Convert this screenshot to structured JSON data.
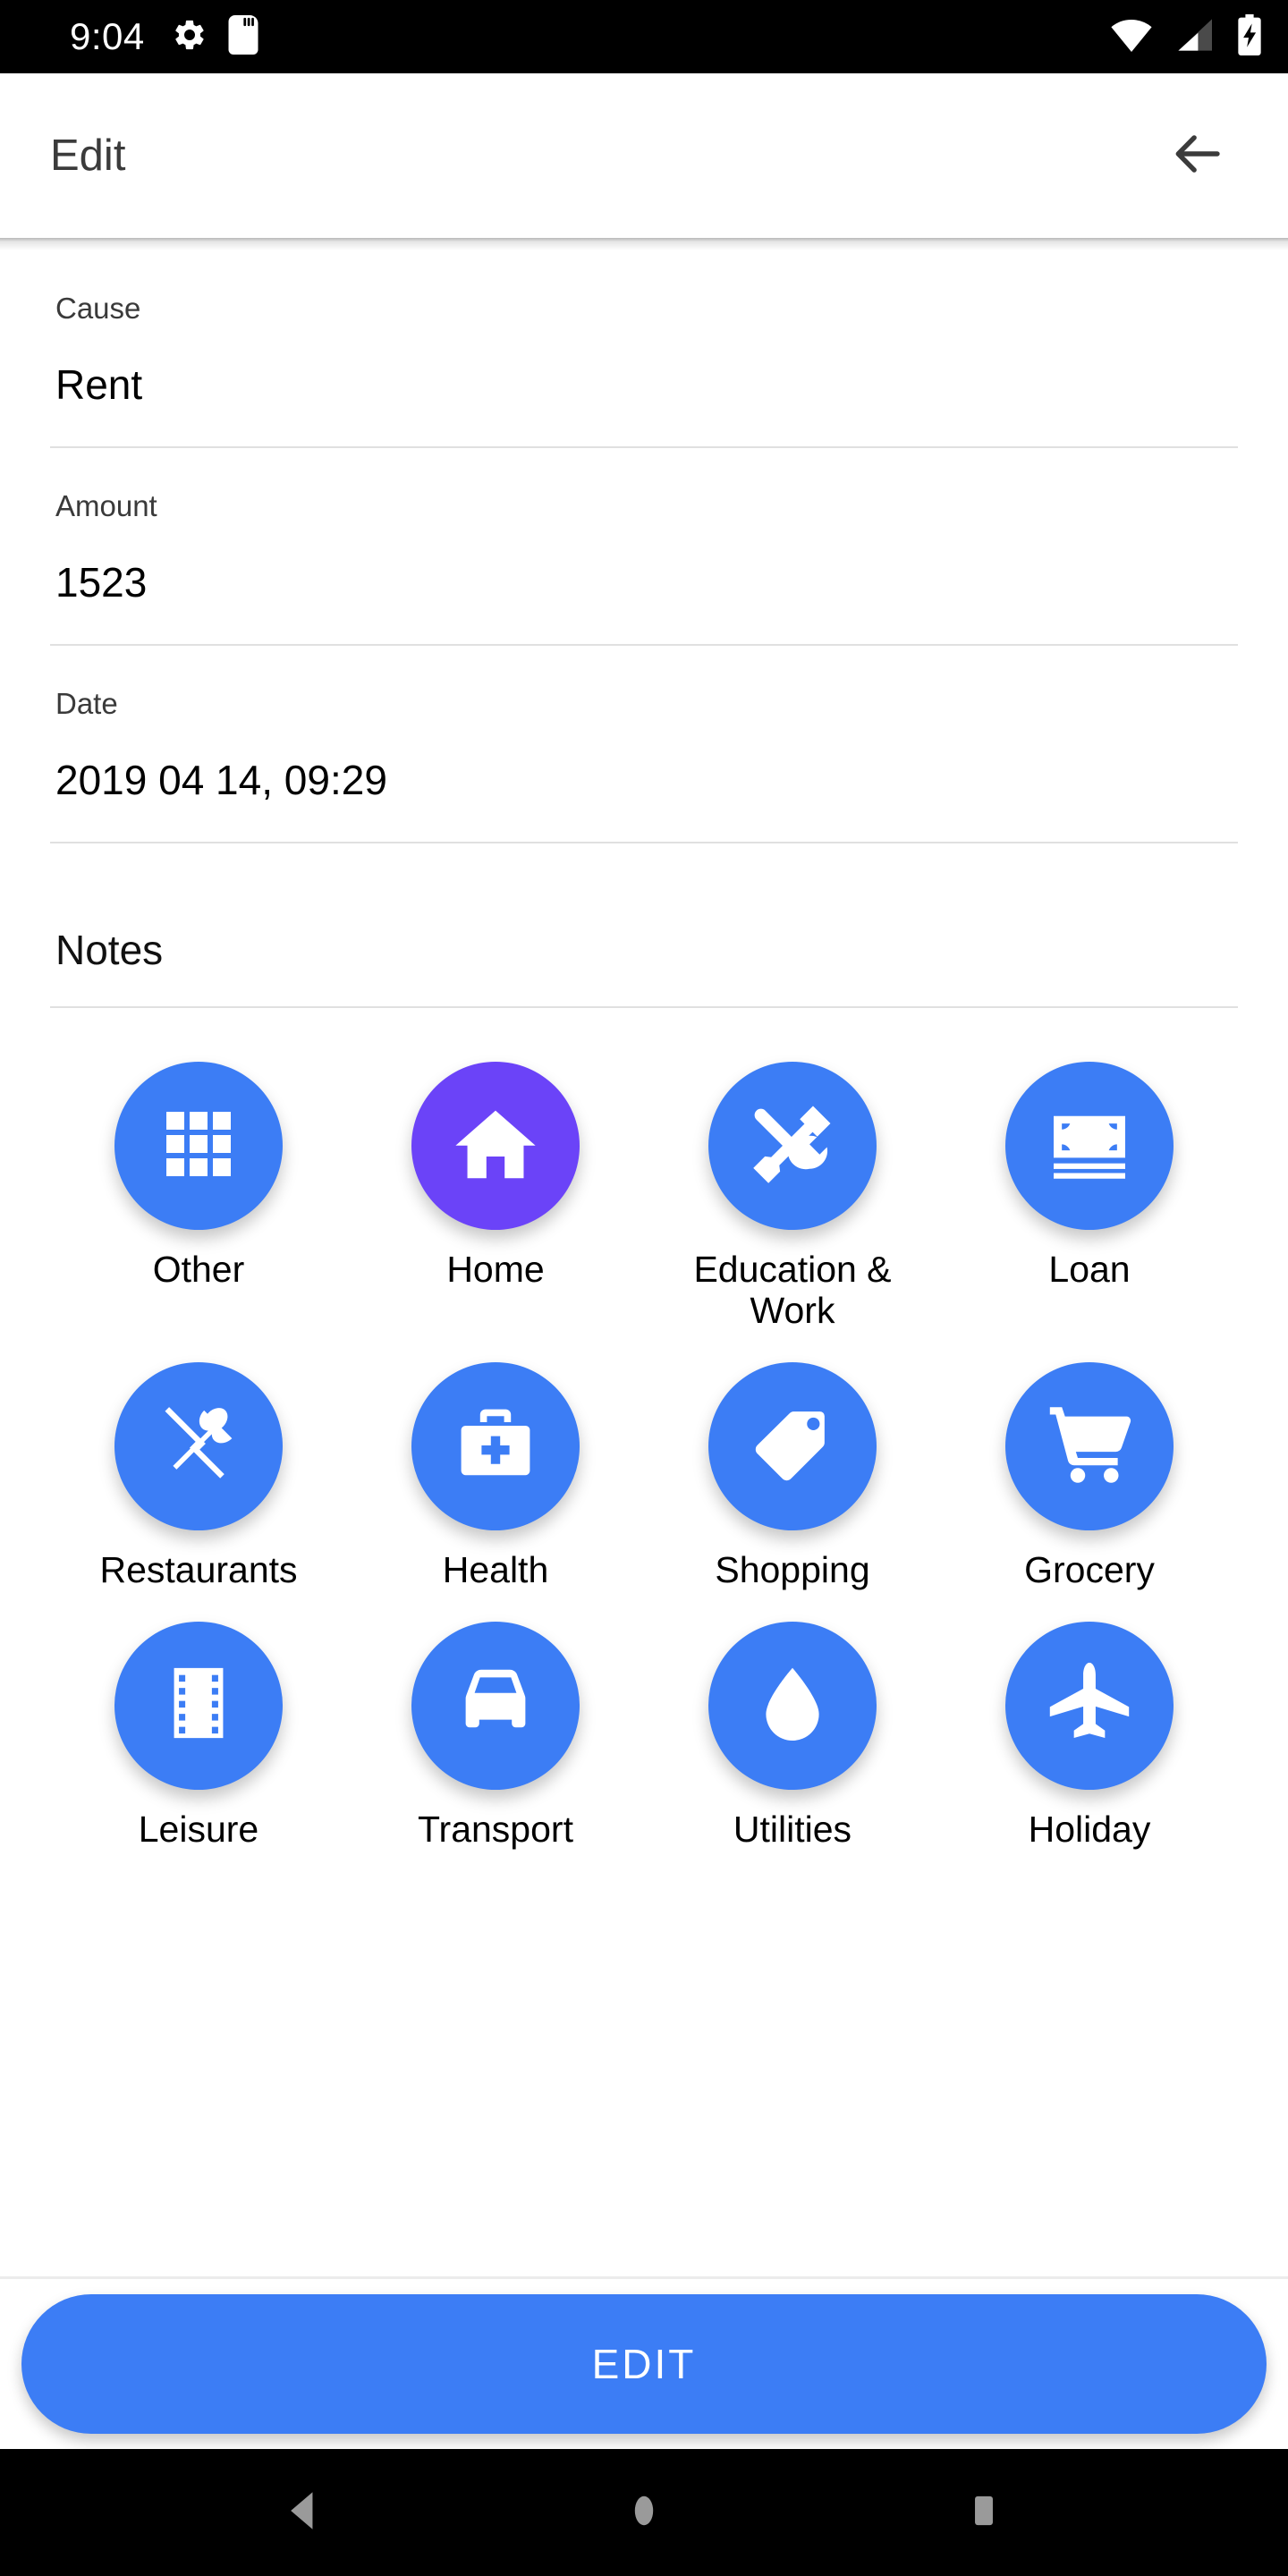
{
  "status_bar": {
    "clock": "9:04",
    "left_icons": [
      "gear-icon",
      "sd-card-icon"
    ],
    "right_icons": [
      "wifi-icon",
      "cellular-signal-icon",
      "battery-charging-icon"
    ],
    "background_color": "#000000",
    "foreground_color": "#ffffff"
  },
  "app_bar": {
    "title": "Edit",
    "back_icon": "arrow-left-icon",
    "title_color": "#3b3b3b"
  },
  "form": {
    "fields": [
      {
        "label": "Cause",
        "value": "Rent"
      },
      {
        "label": "Amount",
        "value": "1523"
      },
      {
        "label": "Date",
        "value": "2019 04 14, 09:29"
      }
    ],
    "notes": {
      "label": "Notes",
      "value": ""
    }
  },
  "categories": {
    "selected": "Home",
    "default_color": "#3c7df5",
    "selected_color": "#6b43f8",
    "icon_color": "#ffffff",
    "items": [
      {
        "label": "Other",
        "icon": "grid-apps-icon",
        "selected": false
      },
      {
        "label": "Home",
        "icon": "house-icon",
        "selected": true
      },
      {
        "label": "Education & Work",
        "icon": "hammer-wrench-icon",
        "selected": false
      },
      {
        "label": "Loan",
        "icon": "banknote-icon",
        "selected": false
      },
      {
        "label": "Restaurants",
        "icon": "knife-spoon-icon",
        "selected": false
      },
      {
        "label": "Health",
        "icon": "medical-bag-icon",
        "selected": false
      },
      {
        "label": "Shopping",
        "icon": "price-tag-icon",
        "selected": false
      },
      {
        "label": "Grocery",
        "icon": "shopping-cart-icon",
        "selected": false
      },
      {
        "label": "Leisure",
        "icon": "film-strip-icon",
        "selected": false
      },
      {
        "label": "Transport",
        "icon": "car-icon",
        "selected": false
      },
      {
        "label": "Utilities",
        "icon": "water-drop-icon",
        "selected": false
      },
      {
        "label": "Holiday",
        "icon": "airplane-icon",
        "selected": false
      }
    ]
  },
  "bottom_action": {
    "label": "EDIT",
    "color": "#3c7df5",
    "text_color": "#ffffff"
  },
  "navigation_bar": {
    "back_icon": "nav-back-triangle-icon",
    "home_icon": "nav-home-circle-icon",
    "recents_icon": "nav-recents-square-icon",
    "icon_color": "#9a9a9a",
    "background_color": "#000000"
  }
}
